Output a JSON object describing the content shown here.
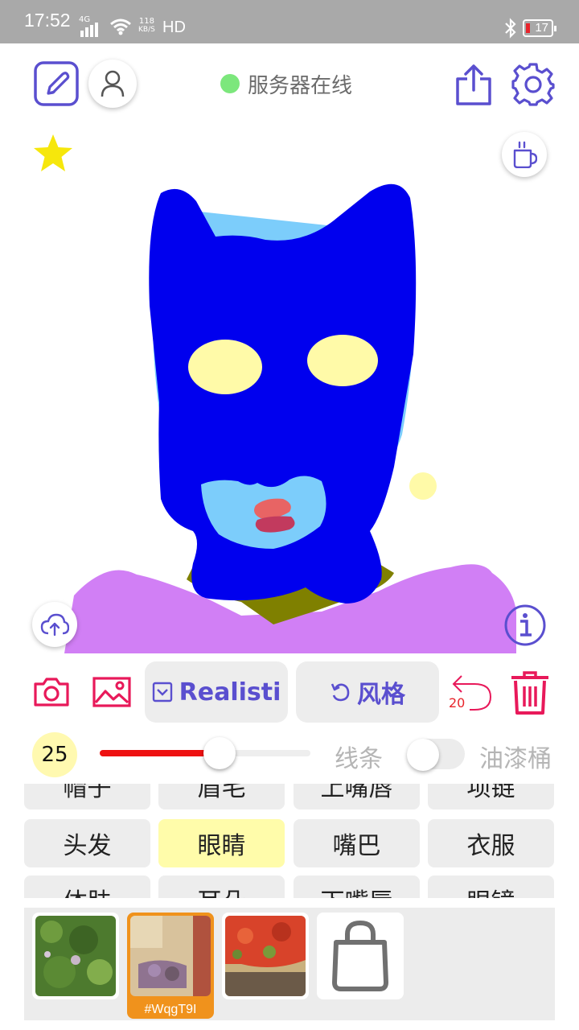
{
  "status_bar": {
    "time": "17:52",
    "network": "4G",
    "speed_value": "118",
    "speed_unit": "KB/S",
    "hd": "HD",
    "battery": "17"
  },
  "header": {
    "server_status": "服务器在线",
    "server_status_color": "#7ce77c"
  },
  "tools": {
    "style_dropdown_label": "Realisti",
    "style_button_label": "风格",
    "undo_count": "20",
    "accent_color": "#5a4fcf",
    "danger_color": "#e8195a"
  },
  "brush": {
    "size": "25",
    "slider_fraction": 0.57,
    "mode_line": "线条",
    "mode_bucket": "油漆桶",
    "bucket_enabled": false
  },
  "parts": {
    "row0": [
      "帽子",
      "眉毛",
      "上嘴唇",
      "项链"
    ],
    "row1": [
      "头发",
      "眼睛",
      "嘴巴",
      "衣服"
    ],
    "row2": [
      "体肤",
      "耳朵",
      "下嘴唇",
      "眼镜"
    ],
    "selected": "眼睛"
  },
  "style_tray": {
    "selected_code": "#WqgT9I"
  }
}
